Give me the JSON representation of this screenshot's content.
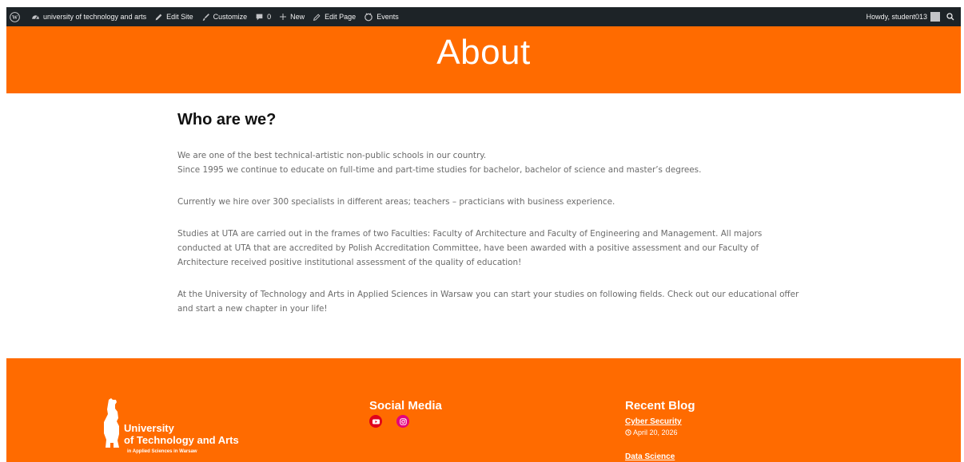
{
  "admin_bar": {
    "site_name": "university of technology and arts",
    "edit_site": "Edit Site",
    "customize": "Customize",
    "comments_count": "0",
    "new": "New",
    "edit_page": "Edit Page",
    "events": "Events",
    "howdy": "Howdy, student013"
  },
  "hero": {
    "title": "About"
  },
  "content": {
    "heading": "Who are we?",
    "p1_line1": "We are one of the best technical-artistic non-public schools in our country.",
    "p1_line2": "Since 1995 we continue to educate on full-time and part-time studies for bachelor, bachelor of science and master’s degrees.",
    "p2": "Currently we hire over 300 specialists in different areas; teachers – practicians with business experience.",
    "p3": "Studies at UTA are carried out in the frames of two Faculties: Faculty of Architecture and Faculty of Engineering and Management. All majors conducted at UTA that are accredited by Polish Accreditation Committee, have been awarded with a positive assessment and our Faculty of Architecture received positive institutional assessment of the quality of education!",
    "p4": "At the University of Technology and Arts in Applied Sciences in Warsaw you can start your studies on following fields. Check out our educational offer and start a new chapter in your life!"
  },
  "footer": {
    "logo_line1": "University",
    "logo_line2": "of Technology and Arts",
    "logo_line3": "in Applied Sciences in Warsaw",
    "social_title": "Social Media",
    "recent_title": "Recent Blog",
    "blog": [
      {
        "title": "Cyber Security",
        "date": "April 20, 2026"
      },
      {
        "title": "Data Science"
      }
    ]
  },
  "colors": {
    "accent": "#ff6b00",
    "admin_bar": "#1d2327",
    "youtube": "#e0001b",
    "instagram": "#e4007c"
  }
}
